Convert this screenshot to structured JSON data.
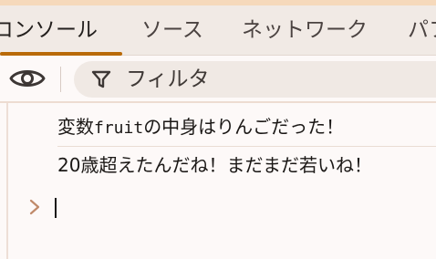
{
  "tabs": [
    {
      "label": "コンソール",
      "active": true
    },
    {
      "label": "ソース",
      "active": false
    },
    {
      "label": "ネットワーク",
      "active": false
    },
    {
      "label": "パフ",
      "active": false
    }
  ],
  "toolbar": {
    "eye_icon": "eye-icon",
    "filter_icon": "funnel-icon",
    "filter_placeholder": "フィルタ"
  },
  "console": {
    "messages": [
      {
        "prefix": "変数",
        "code": "fruit",
        "suffix": "の中身はりんごだった！"
      },
      {
        "text": "20歳超えたんだね！まだまだ若いね！"
      }
    ],
    "prompt_icon": "chevron-right-icon",
    "input_value": ""
  },
  "colors": {
    "accent": "#b96a08",
    "tabbar_bg": "#f1eae5",
    "top_strip": "#f6d9bb",
    "filter_bg": "#f0e9e4",
    "page_bg": "#fdf9f8"
  }
}
